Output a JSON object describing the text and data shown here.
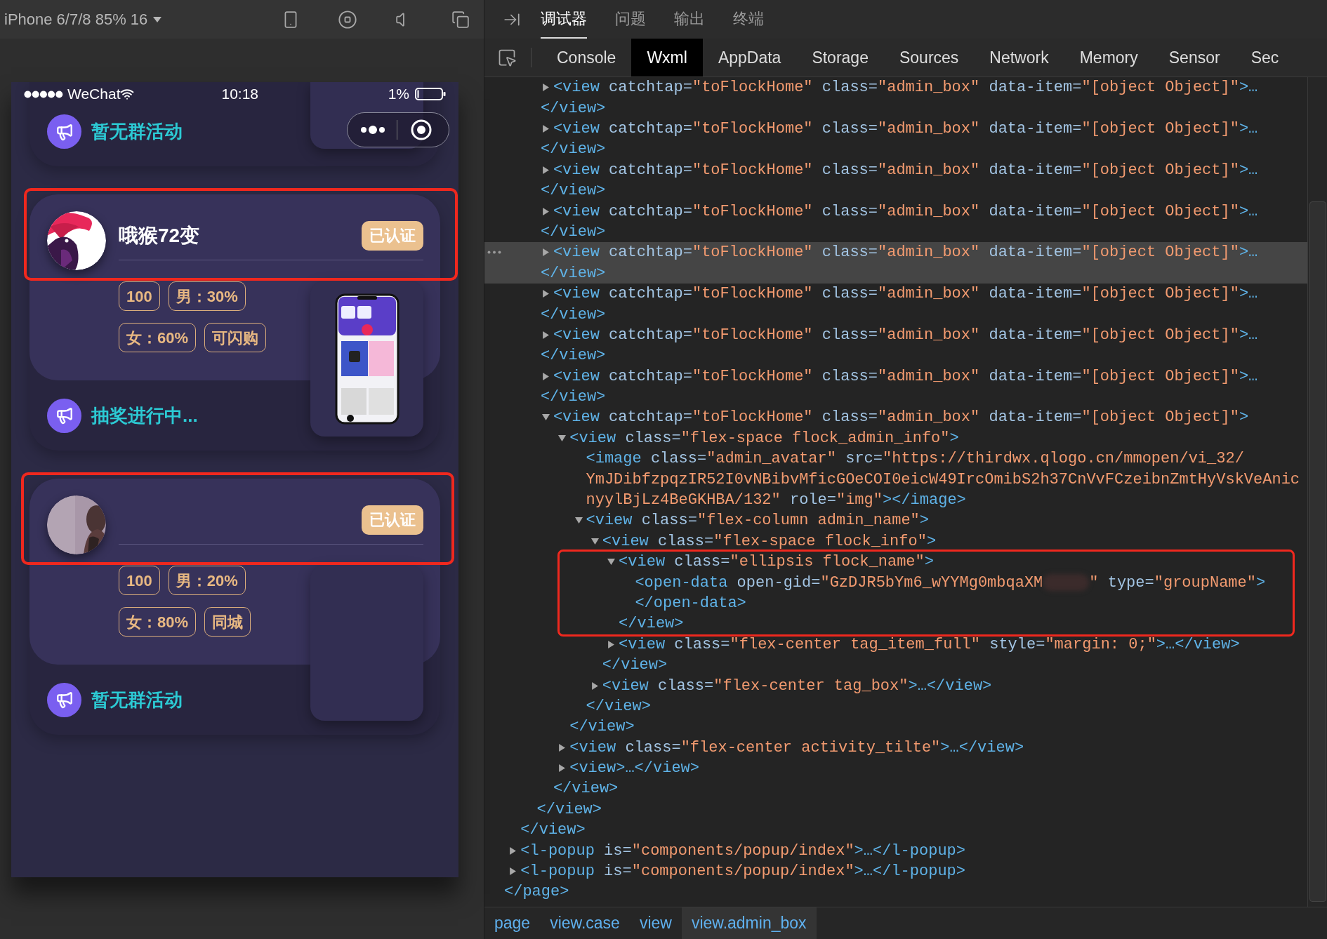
{
  "simulator": {
    "device": "iPhone 6/7/8 85% 16",
    "status_bar": {
      "carrier": "WeChat",
      "time": "10:18",
      "battery": "1%"
    },
    "groups": [
      {
        "kind": "partial",
        "activity": "暂无群活动",
        "thumbnail": {
          "kind": "empty"
        }
      },
      {
        "kind": "full",
        "name": "哦猴72变",
        "badge": "已认证",
        "tags": [
          "100",
          "男：30%",
          "女：60%",
          "可闪购"
        ],
        "activity": "抽奖进行中...",
        "thumbnail": {
          "kind": "picture"
        },
        "highlighted": true
      },
      {
        "kind": "full",
        "badge": "已认证",
        "tags": [
          "100",
          "男：20%",
          "女：80%",
          "同城"
        ],
        "activity": "暂无群活动",
        "thumbnail": {
          "kind": "empty"
        },
        "highlighted": true
      }
    ]
  },
  "devtools": {
    "tabs": [
      {
        "label": "调试器",
        "selected": true
      },
      {
        "label": "问题",
        "selected": false
      },
      {
        "label": "输出",
        "selected": false
      },
      {
        "label": "终端",
        "selected": false
      }
    ],
    "panel_tabs": [
      {
        "label": "Console",
        "selected": false
      },
      {
        "label": "Wxml",
        "selected": true
      },
      {
        "label": "AppData",
        "selected": false
      },
      {
        "label": "Storage",
        "selected": false
      },
      {
        "label": "Sources",
        "selected": false
      },
      {
        "label": "Network",
        "selected": false
      },
      {
        "label": "Memory",
        "selected": false
      },
      {
        "label": "Sensor",
        "selected": false
      },
      {
        "label": "Sec",
        "selected": false
      }
    ],
    "wxml_tree": {
      "selected": false,
      "close": [
        {
          "kind": "tag",
          "text": "</page>"
        }
      ],
      "children": [
        {
          "selected": false,
          "close": [
            {
              "kind": "tag",
              "text": "</view>"
            }
          ],
          "children": [
            {
              "selected": false,
              "close": [
                {
                  "kind": "tag",
                  "text": "</view>"
                }
              ],
              "children": [
                {
                  "open": [
                    [
                      {
                        "kind": "tag",
                        "text": "<view"
                      },
                      {
                        "kind": "attr",
                        "text": " catchtap="
                      },
                      {
                        "kind": "val",
                        "text": "\"toFlockHome\""
                      },
                      {
                        "kind": "attr",
                        "text": " class="
                      },
                      {
                        "kind": "val",
                        "text": "\"admin_box\""
                      },
                      {
                        "kind": "attr",
                        "text": " data-item="
                      },
                      {
                        "kind": "val",
                        "text": "\"[object Object]\""
                      },
                      {
                        "kind": "tag",
                        "text": ">…"
                      }
                    ]
                  ],
                  "expanded": false,
                  "close_wrapped": true,
                  "close": [
                    {
                      "kind": "tag",
                      "text": "</view>"
                    }
                  ],
                  "selected": false
                },
                {
                  "open": [
                    [
                      {
                        "kind": "tag",
                        "text": "<view"
                      },
                      {
                        "kind": "attr",
                        "text": " catchtap="
                      },
                      {
                        "kind": "val",
                        "text": "\"toFlockHome\""
                      },
                      {
                        "kind": "attr",
                        "text": " class="
                      },
                      {
                        "kind": "val",
                        "text": "\"admin_box\""
                      },
                      {
                        "kind": "attr",
                        "text": " data-item="
                      },
                      {
                        "kind": "val",
                        "text": "\"[object Object]\""
                      },
                      {
                        "kind": "tag",
                        "text": ">…"
                      }
                    ]
                  ],
                  "expanded": false,
                  "close_wrapped": true,
                  "close": [
                    {
                      "kind": "tag",
                      "text": "</view>"
                    }
                  ],
                  "selected": false
                },
                {
                  "open": [
                    [
                      {
                        "kind": "tag",
                        "text": "<view"
                      },
                      {
                        "kind": "attr",
                        "text": " catchtap="
                      },
                      {
                        "kind": "val",
                        "text": "\"toFlockHome\""
                      },
                      {
                        "kind": "attr",
                        "text": " class="
                      },
                      {
                        "kind": "val",
                        "text": "\"admin_box\""
                      },
                      {
                        "kind": "attr",
                        "text": " data-item="
                      },
                      {
                        "kind": "val",
                        "text": "\"[object Object]\""
                      },
                      {
                        "kind": "tag",
                        "text": ">…"
                      }
                    ]
                  ],
                  "expanded": false,
                  "close_wrapped": true,
                  "close": [
                    {
                      "kind": "tag",
                      "text": "</view>"
                    }
                  ],
                  "selected": false
                },
                {
                  "open": [
                    [
                      {
                        "kind": "tag",
                        "text": "<view"
                      },
                      {
                        "kind": "attr",
                        "text": " catchtap="
                      },
                      {
                        "kind": "val",
                        "text": "\"toFlockHome\""
                      },
                      {
                        "kind": "attr",
                        "text": " class="
                      },
                      {
                        "kind": "val",
                        "text": "\"admin_box\""
                      },
                      {
                        "kind": "attr",
                        "text": " data-item="
                      },
                      {
                        "kind": "val",
                        "text": "\"[object Object]\""
                      },
                      {
                        "kind": "tag",
                        "text": ">…"
                      }
                    ]
                  ],
                  "expanded": false,
                  "close_wrapped": true,
                  "close": [
                    {
                      "kind": "tag",
                      "text": "</view>"
                    }
                  ],
                  "selected": false
                },
                {
                  "open": [
                    [
                      {
                        "kind": "tag",
                        "text": "<view"
                      },
                      {
                        "kind": "attr",
                        "text": " catchtap="
                      },
                      {
                        "kind": "val",
                        "text": "\"toFlockHome\""
                      },
                      {
                        "kind": "attr",
                        "text": " class="
                      },
                      {
                        "kind": "val",
                        "text": "\"admin_box\""
                      },
                      {
                        "kind": "attr",
                        "text": " data-item="
                      },
                      {
                        "kind": "val",
                        "text": "\"[object Object]\""
                      },
                      {
                        "kind": "tag",
                        "text": ">…"
                      }
                    ]
                  ],
                  "expanded": false,
                  "close_wrapped": true,
                  "close": [
                    {
                      "kind": "tag",
                      "text": "</view>"
                    }
                  ],
                  "selected": true
                },
                {
                  "open": [
                    [
                      {
                        "kind": "tag",
                        "text": "<view"
                      },
                      {
                        "kind": "attr",
                        "text": " catchtap="
                      },
                      {
                        "kind": "val",
                        "text": "\"toFlockHome\""
                      },
                      {
                        "kind": "attr",
                        "text": " class="
                      },
                      {
                        "kind": "val",
                        "text": "\"admin_box\""
                      },
                      {
                        "kind": "attr",
                        "text": " data-item="
                      },
                      {
                        "kind": "val",
                        "text": "\"[object Object]\""
                      },
                      {
                        "kind": "tag",
                        "text": ">…"
                      }
                    ]
                  ],
                  "expanded": false,
                  "close_wrapped": true,
                  "close": [
                    {
                      "kind": "tag",
                      "text": "</view>"
                    }
                  ],
                  "selected": false
                },
                {
                  "open": [
                    [
                      {
                        "kind": "tag",
                        "text": "<view"
                      },
                      {
                        "kind": "attr",
                        "text": " catchtap="
                      },
                      {
                        "kind": "val",
                        "text": "\"toFlockHome\""
                      },
                      {
                        "kind": "attr",
                        "text": " class="
                      },
                      {
                        "kind": "val",
                        "text": "\"admin_box\""
                      },
                      {
                        "kind": "attr",
                        "text": " data-item="
                      },
                      {
                        "kind": "val",
                        "text": "\"[object Object]\""
                      },
                      {
                        "kind": "tag",
                        "text": ">…"
                      }
                    ]
                  ],
                  "expanded": false,
                  "close_wrapped": true,
                  "close": [
                    {
                      "kind": "tag",
                      "text": "</view>"
                    }
                  ],
                  "selected": false
                },
                {
                  "open": [
                    [
                      {
                        "kind": "tag",
                        "text": "<view"
                      },
                      {
                        "kind": "attr",
                        "text": " catchtap="
                      },
                      {
                        "kind": "val",
                        "text": "\"toFlockHome\""
                      },
                      {
                        "kind": "attr",
                        "text": " class="
                      },
                      {
                        "kind": "val",
                        "text": "\"admin_box\""
                      },
                      {
                        "kind": "attr",
                        "text": " data-item="
                      },
                      {
                        "kind": "val",
                        "text": "\"[object Object]\""
                      },
                      {
                        "kind": "tag",
                        "text": ">…"
                      }
                    ]
                  ],
                  "expanded": false,
                  "close_wrapped": true,
                  "close": [
                    {
                      "kind": "tag",
                      "text": "</view>"
                    }
                  ],
                  "selected": false
                },
                {
                  "open": [
                    [
                      {
                        "kind": "tag",
                        "text": "<view"
                      },
                      {
                        "kind": "attr",
                        "text": " catchtap="
                      },
                      {
                        "kind": "val",
                        "text": "\"toFlockHome\""
                      },
                      {
                        "kind": "attr",
                        "text": " class="
                      },
                      {
                        "kind": "val",
                        "text": "\"admin_box\""
                      },
                      {
                        "kind": "attr",
                        "text": " data-item="
                      },
                      {
                        "kind": "val",
                        "text": "\"[object Object]\""
                      },
                      {
                        "kind": "tag",
                        "text": ">"
                      }
                    ]
                  ],
                  "expanded": true,
                  "selected": false,
                  "close": [
                    {
                      "kind": "tag",
                      "text": "</view>"
                    }
                  ],
                  "children": [
                    {
                      "open": [
                        [
                          {
                            "kind": "tag",
                            "text": "<view"
                          },
                          {
                            "kind": "attr",
                            "text": " class="
                          },
                          {
                            "kind": "val",
                            "text": "\"flex-space flock_admin_info\""
                          },
                          {
                            "kind": "tag",
                            "text": ">"
                          }
                        ]
                      ],
                      "expanded": true,
                      "selected": false,
                      "close": [
                        {
                          "kind": "tag",
                          "text": "</view>"
                        }
                      ],
                      "children": [
                        {
                          "open": [
                            [
                              {
                                "kind": "tag",
                                "text": "<image"
                              },
                              {
                                "kind": "attr",
                                "text": " class="
                              },
                              {
                                "kind": "val",
                                "text": "\"admin_avatar\""
                              },
                              {
                                "kind": "attr",
                                "text": " src="
                              },
                              {
                                "kind": "val",
                                "text": "\"https://thirdwx.qlogo.cn/mmopen/vi_32/"
                              }
                            ],
                            [
                              {
                                "kind": "val",
                                "text": "YmJDibfzpqzIR52I0vNBibvMficGOeCOI0eicW49IrcOmibS2h37CnVvFCzeibnZmtHyVskVeAnic"
                              }
                            ],
                            [
                              {
                                "kind": "val",
                                "text": "nyylBjLz4BeGKHBA/132\""
                              },
                              {
                                "kind": "attr",
                                "text": " role="
                              },
                              {
                                "kind": "val",
                                "text": "\"img\""
                              },
                              {
                                "kind": "tag",
                                "text": "></image>"
                              }
                            ]
                          ],
                          "selected": false
                        },
                        {
                          "open": [
                            [
                              {
                                "kind": "tag",
                                "text": "<view"
                              },
                              {
                                "kind": "attr",
                                "text": " class="
                              },
                              {
                                "kind": "val",
                                "text": "\"flex-column admin_name\""
                              },
                              {
                                "kind": "tag",
                                "text": ">"
                              }
                            ]
                          ],
                          "expanded": true,
                          "selected": false,
                          "close": [
                            {
                              "kind": "tag",
                              "text": "</view>"
                            }
                          ],
                          "children": [
                            {
                              "open": [
                                [
                                  {
                                    "kind": "tag",
                                    "text": "<view"
                                  },
                                  {
                                    "kind": "attr",
                                    "text": " class="
                                  },
                                  {
                                    "kind": "val",
                                    "text": "\"flex-space flock_info\""
                                  },
                                  {
                                    "kind": "tag",
                                    "text": ">"
                                  }
                                ]
                              ],
                              "expanded": true,
                              "selected": false,
                              "close": [
                                {
                                  "kind": "tag",
                                  "text": "</view>"
                                }
                              ],
                              "children": [
                                {
                                  "open": [
                                    [
                                      {
                                        "kind": "tag",
                                        "text": "<view"
                                      },
                                      {
                                        "kind": "attr",
                                        "text": " class="
                                      },
                                      {
                                        "kind": "val",
                                        "text": "\"ellipsis flock_name\""
                                      },
                                      {
                                        "kind": "tag",
                                        "text": ">"
                                      }
                                    ]
                                  ],
                                  "expanded": true,
                                  "selected": false,
                                  "highlighted": true,
                                  "close": [
                                    {
                                      "kind": "tag",
                                      "text": "</view>"
                                    }
                                  ],
                                  "children": [
                                    {
                                      "open": [
                                        [
                                          {
                                            "kind": "tag",
                                            "text": "<open-data"
                                          },
                                          {
                                            "kind": "attr",
                                            "text": " open-gid="
                                          },
                                          {
                                            "kind": "val",
                                            "text": "\"GzDJR5bYm6_wYYMg0mbqaXM"
                                          },
                                          {
                                            "kind": "redacted"
                                          },
                                          {
                                            "kind": "val",
                                            "text": "\""
                                          },
                                          {
                                            "kind": "attr",
                                            "text": " type="
                                          },
                                          {
                                            "kind": "val",
                                            "text": "\"groupName\""
                                          },
                                          {
                                            "kind": "tag",
                                            "text": ">"
                                          }
                                        ]
                                      ],
                                      "selected": false,
                                      "close": [
                                        {
                                          "kind": "tag",
                                          "text": "</open-data>"
                                        }
                                      ]
                                    }
                                  ]
                                },
                                {
                                  "open": [
                                    [
                                      {
                                        "kind": "tag",
                                        "text": "<view"
                                      },
                                      {
                                        "kind": "attr",
                                        "text": " class="
                                      },
                                      {
                                        "kind": "val",
                                        "text": "\"flex-center tag_item_full\""
                                      },
                                      {
                                        "kind": "attr",
                                        "text": " style="
                                      },
                                      {
                                        "kind": "val",
                                        "text": "\"margin: 0;\""
                                      },
                                      {
                                        "kind": "tag",
                                        "text": ">…</view>"
                                      }
                                    ]
                                  ],
                                  "expanded": false,
                                  "selected": false
                                }
                              ]
                            },
                            {
                              "open": [
                                [
                                  {
                                    "kind": "tag",
                                    "text": "<view"
                                  },
                                  {
                                    "kind": "attr",
                                    "text": " class="
                                  },
                                  {
                                    "kind": "val",
                                    "text": "\"flex-center tag_box\""
                                  },
                                  {
                                    "kind": "tag",
                                    "text": ">…</view>"
                                  }
                                ]
                              ],
                              "expanded": false,
                              "selected": false
                            }
                          ]
                        }
                      ]
                    },
                    {
                      "open": [
                        [
                          {
                            "kind": "tag",
                            "text": "<view"
                          },
                          {
                            "kind": "attr",
                            "text": " class="
                          },
                          {
                            "kind": "val",
                            "text": "\"flex-center activity_tilte\""
                          },
                          {
                            "kind": "tag",
                            "text": ">…</view>"
                          }
                        ]
                      ],
                      "expanded": false,
                      "selected": false
                    },
                    {
                      "open": [
                        [
                          {
                            "kind": "tag",
                            "text": "<view>…</view>"
                          }
                        ]
                      ],
                      "expanded": false,
                      "selected": false
                    }
                  ]
                }
              ]
            }
          ]
        },
        {
          "open": [
            [
              {
                "kind": "tag",
                "text": "<l-popup"
              },
              {
                "kind": "attr",
                "text": " is="
              },
              {
                "kind": "val",
                "text": "\"components/popup/index\""
              },
              {
                "kind": "tag",
                "text": ">…</l-popup>"
              }
            ]
          ],
          "expanded": false,
          "selected": false
        },
        {
          "open": [
            [
              {
                "kind": "tag",
                "text": "<l-popup"
              },
              {
                "kind": "attr",
                "text": " is="
              },
              {
                "kind": "val",
                "text": "\"components/popup/index\""
              },
              {
                "kind": "tag",
                "text": ">…</l-popup>"
              }
            ]
          ],
          "expanded": false,
          "selected": false
        }
      ]
    },
    "breadcrumb": [
      {
        "label": "page",
        "selected": false
      },
      {
        "label": "view.case",
        "selected": false
      },
      {
        "label": "view",
        "selected": false
      },
      {
        "label": "view.admin_box",
        "selected": true
      }
    ]
  }
}
